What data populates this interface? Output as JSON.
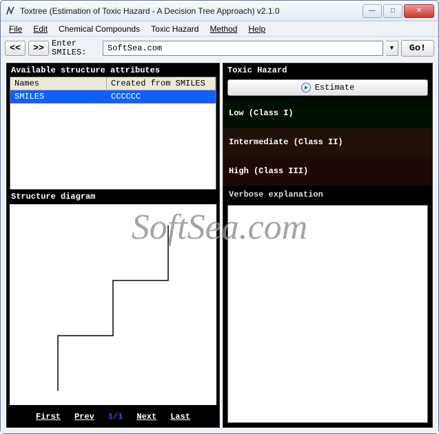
{
  "window": {
    "title": "Toxtree (Estimation of Toxic Hazard - A Decision Tree Approach) v2.1.0"
  },
  "menu": {
    "file": "File",
    "edit": "Edit",
    "compounds": "Chemical Compounds",
    "hazard": "Toxic Hazard",
    "method": "Method",
    "help": "Help"
  },
  "toolbar": {
    "prev_label": "<<",
    "next_label": ">>",
    "enter_label": "Enter\nSMILES:",
    "input_value": "SoftSea.com",
    "go_label": "Go!"
  },
  "attributes": {
    "title": "Available structure attributes",
    "col_name": "Names",
    "col_value": "Created from SMILES",
    "row_name": "SMILES",
    "row_value": "CCCCCC"
  },
  "diagram": {
    "title": "Structure diagram"
  },
  "pager": {
    "first": "First",
    "prev": "Prev",
    "counter": "1/1",
    "next": "Next",
    "last": "Last"
  },
  "hazard": {
    "title": "Toxic Hazard",
    "estimate": "Estimate",
    "low": "Low (Class I)",
    "mid": "Intermediate (Class II)",
    "high": "High (Class III)",
    "explanation_title": "Verbose explanation"
  },
  "watermark": "SoftSea.com"
}
